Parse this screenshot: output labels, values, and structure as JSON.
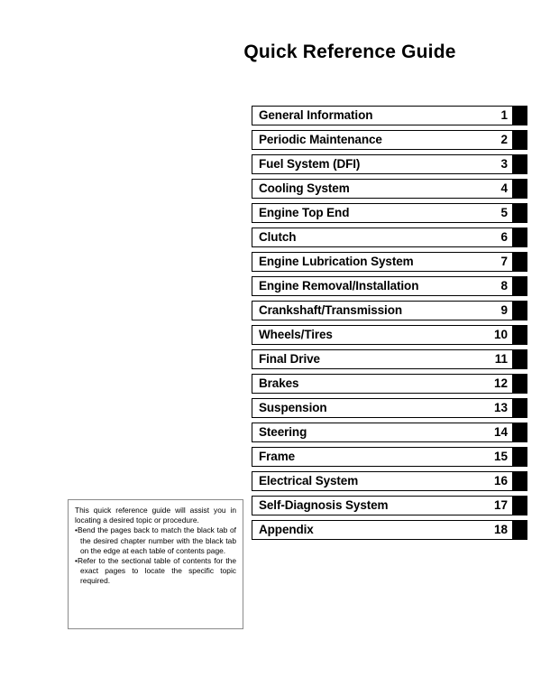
{
  "page": {
    "title": "Quick Reference Guide"
  },
  "chapters": [
    {
      "label": "General Information",
      "number": "1"
    },
    {
      "label": "Periodic Maintenance",
      "number": "2"
    },
    {
      "label": "Fuel System (DFI)",
      "number": "3"
    },
    {
      "label": "Cooling System",
      "number": "4"
    },
    {
      "label": "Engine Top End",
      "number": "5"
    },
    {
      "label": "Clutch",
      "number": "6"
    },
    {
      "label": "Engine Lubrication System",
      "number": "7"
    },
    {
      "label": "Engine Removal/Installation",
      "number": "8"
    },
    {
      "label": "Crankshaft/Transmission",
      "number": "9"
    },
    {
      "label": "Wheels/Tires",
      "number": "10"
    },
    {
      "label": "Final Drive",
      "number": "11"
    },
    {
      "label": "Brakes",
      "number": "12"
    },
    {
      "label": "Suspension",
      "number": "13"
    },
    {
      "label": "Steering",
      "number": "14"
    },
    {
      "label": "Frame",
      "number": "15"
    },
    {
      "label": "Electrical System",
      "number": "16"
    },
    {
      "label": "Self-Diagnosis System",
      "number": "17"
    },
    {
      "label": "Appendix",
      "number": "18"
    }
  ],
  "note": {
    "intro": "This quick reference guide will assist you in locating a desired topic or procedure.",
    "bullet_marker": "•",
    "bullets": [
      "Bend the pages back to match the black tab of the desired chapter number with the black tab on the edge at each table of contents page.",
      "Refer to the sectional table of contents for the exact pages to locate the specific topic required."
    ]
  }
}
